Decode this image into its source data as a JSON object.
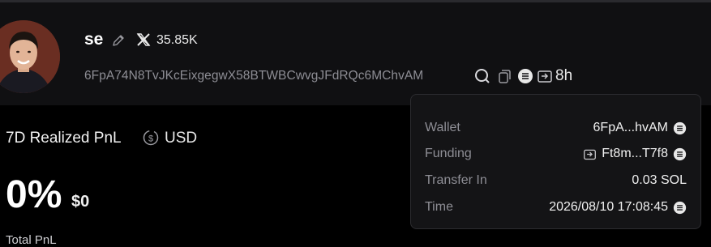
{
  "profile": {
    "username": "se",
    "followers": "35.85K",
    "address": "6FpA74N8TvJKcEixgegwX58BTWBCwvgJFdRQc6MChvAM",
    "age": "8h"
  },
  "pnl": {
    "title": "7D Realized PnL",
    "currency": "USD",
    "percent": "0%",
    "usd_value": "$0",
    "total_label": "Total PnL"
  },
  "tooltip": {
    "rows": [
      {
        "label": "Wallet",
        "value": "6FpA...hvAM"
      },
      {
        "label": "Funding",
        "value": "Ft8m...T7f8"
      },
      {
        "label": "Transfer In",
        "value": "0.03 SOL"
      },
      {
        "label": "Time",
        "value": "2026/08/10 17:08:45"
      }
    ]
  },
  "colors": {
    "background": "#000000",
    "header": "#101012",
    "muted_text": "#8e8e95",
    "tooltip_bg": "#141416"
  }
}
